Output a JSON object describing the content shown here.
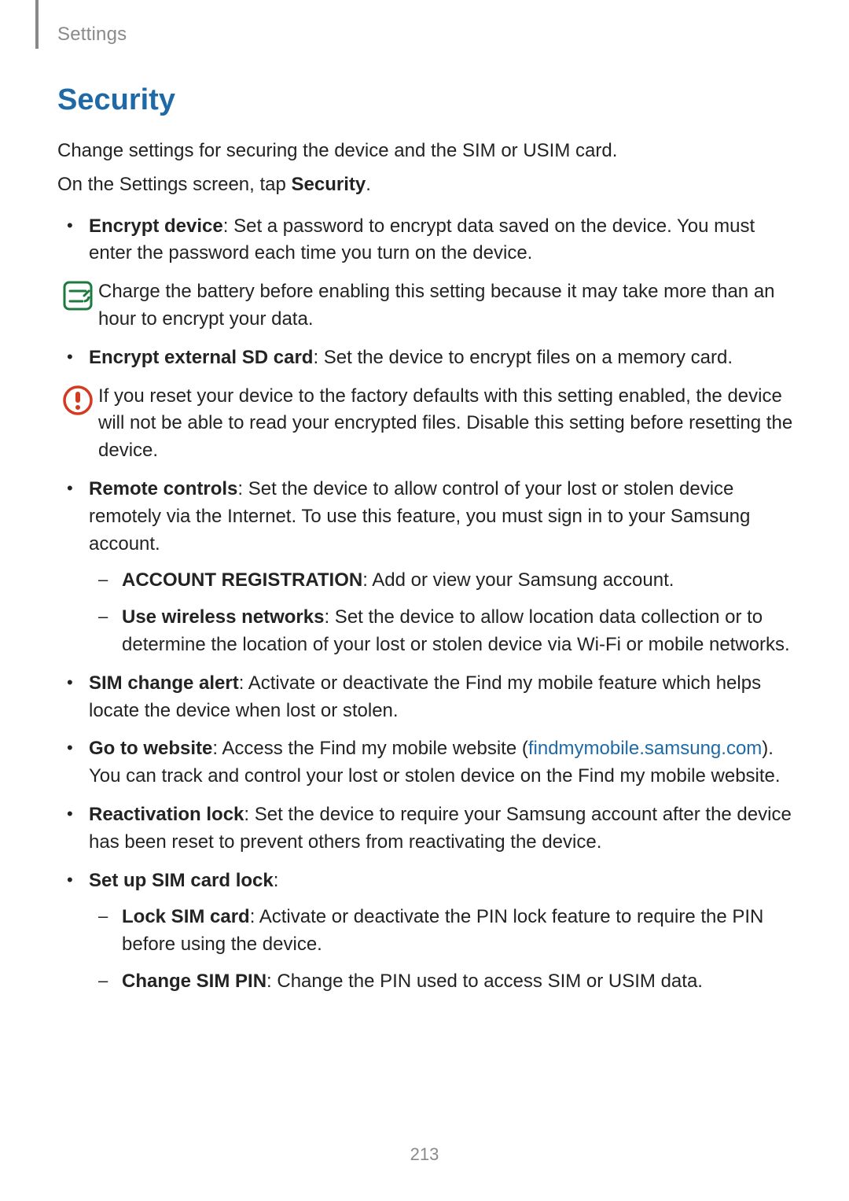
{
  "header": {
    "section": "Settings"
  },
  "title": "Security",
  "intro1": "Change settings for securing the device and the SIM or USIM card.",
  "intro2_pre": "On the Settings screen, tap ",
  "intro2_bold": "Security",
  "intro2_post": ".",
  "b1": {
    "label": "Encrypt device",
    "text": ": Set a password to encrypt data saved on the device. You must enter the password each time you turn on the device."
  },
  "note1": "Charge the battery before enabling this setting because it may take more than an hour to encrypt your data.",
  "b2": {
    "label": "Encrypt external SD card",
    "text": ": Set the device to encrypt files on a memory card."
  },
  "warn1": "If you reset your device to the factory defaults with this setting enabled, the device will not be able to read your encrypted files. Disable this setting before resetting the device.",
  "b3": {
    "label": "Remote controls",
    "text": ": Set the device to allow control of your lost or stolen device remotely via the Internet. To use this feature, you must sign in to your Samsung account."
  },
  "b3a": {
    "label": "ACCOUNT REGISTRATION",
    "text": ": Add or view your Samsung account."
  },
  "b3b": {
    "label": "Use wireless networks",
    "text": ": Set the device to allow location data collection or to determine the location of your lost or stolen device via Wi-Fi or mobile networks."
  },
  "b4": {
    "label": "SIM change alert",
    "text": ": Activate or deactivate the Find my mobile feature which helps locate the device when lost or stolen."
  },
  "b5": {
    "label": "Go to website",
    "text_pre": ": Access the Find my mobile website (",
    "link": "findmymobile.samsung.com",
    "text_post": "). You can track and control your lost or stolen device on the Find my mobile website."
  },
  "b6": {
    "label": "Reactivation lock",
    "text": ": Set the device to require your Samsung account after the device has been reset to prevent others from reactivating the device."
  },
  "b7": {
    "label": "Set up SIM card lock",
    "text": ":"
  },
  "b7a": {
    "label": "Lock SIM card",
    "text": ": Activate or deactivate the PIN lock feature to require the PIN before using the device."
  },
  "b7b": {
    "label": "Change SIM PIN",
    "text": ": Change the PIN used to access SIM or USIM data."
  },
  "page_number": "213"
}
